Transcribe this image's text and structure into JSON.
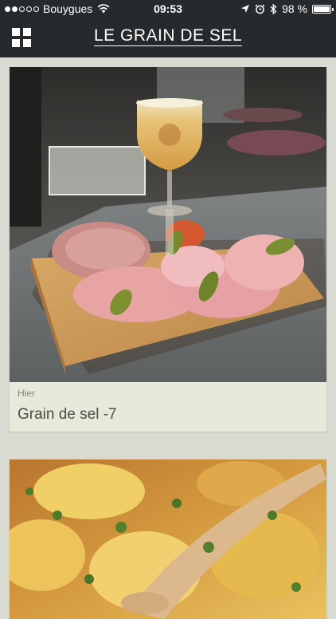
{
  "status_bar": {
    "carrier": "Bouygues",
    "time": "09:53",
    "battery": "98 %",
    "battery_level": 0.98,
    "signal_bars_filled": 2,
    "signal_bars_total": 5
  },
  "header": {
    "title": "LE GRAIN DE SEL",
    "menu_icon": "grid-icon"
  },
  "feed": [
    {
      "date": "Hier",
      "title": "Grain de sel -7",
      "image": "charcuterie board with glass of beer on bar counter"
    },
    {
      "image": "sautéed potatoes with herbs and wooden spoon"
    }
  ],
  "colors": {
    "bar_background": "#262a2c",
    "page_background": "#d9dbd2",
    "card_background": "#e9e9db",
    "text_dark": "#4b4e47",
    "text_muted": "#858579"
  }
}
